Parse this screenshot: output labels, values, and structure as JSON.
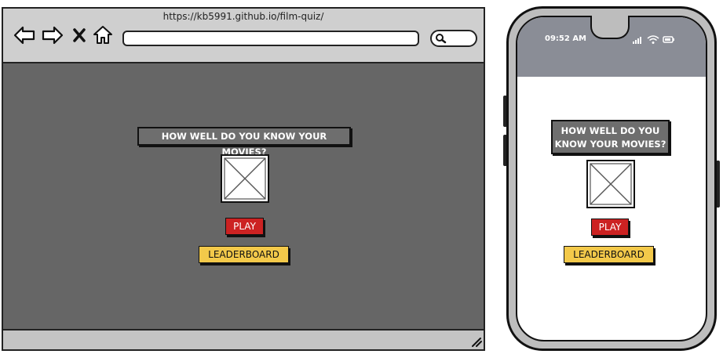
{
  "browser": {
    "url": "https://kb5991.github.io/film-quiz/",
    "icons": [
      "back-arrow-icon",
      "forward-arrow-icon",
      "close-icon",
      "home-icon",
      "search-icon",
      "resize-grip-icon"
    ]
  },
  "page": {
    "title": "HOW WELL DO YOU KNOW YOUR MOVIES?",
    "play_label": "PLAY",
    "leaderboard_label": "LEADERBOARD"
  },
  "phone": {
    "time": "09:52 AM",
    "title_line1": "HOW WELL DO YOU",
    "title_line2": "KNOW YOUR MOVIES?",
    "play_label": "PLAY",
    "leaderboard_label": "LEADERBOARD",
    "status_icons": [
      "signal-icon",
      "wifi-icon",
      "battery-icon"
    ]
  },
  "colors": {
    "content_bg": "#666666",
    "play_button": "#cc2222",
    "leaderboard_button": "#f3c94a",
    "phone_status_bar": "#8a8d96"
  }
}
